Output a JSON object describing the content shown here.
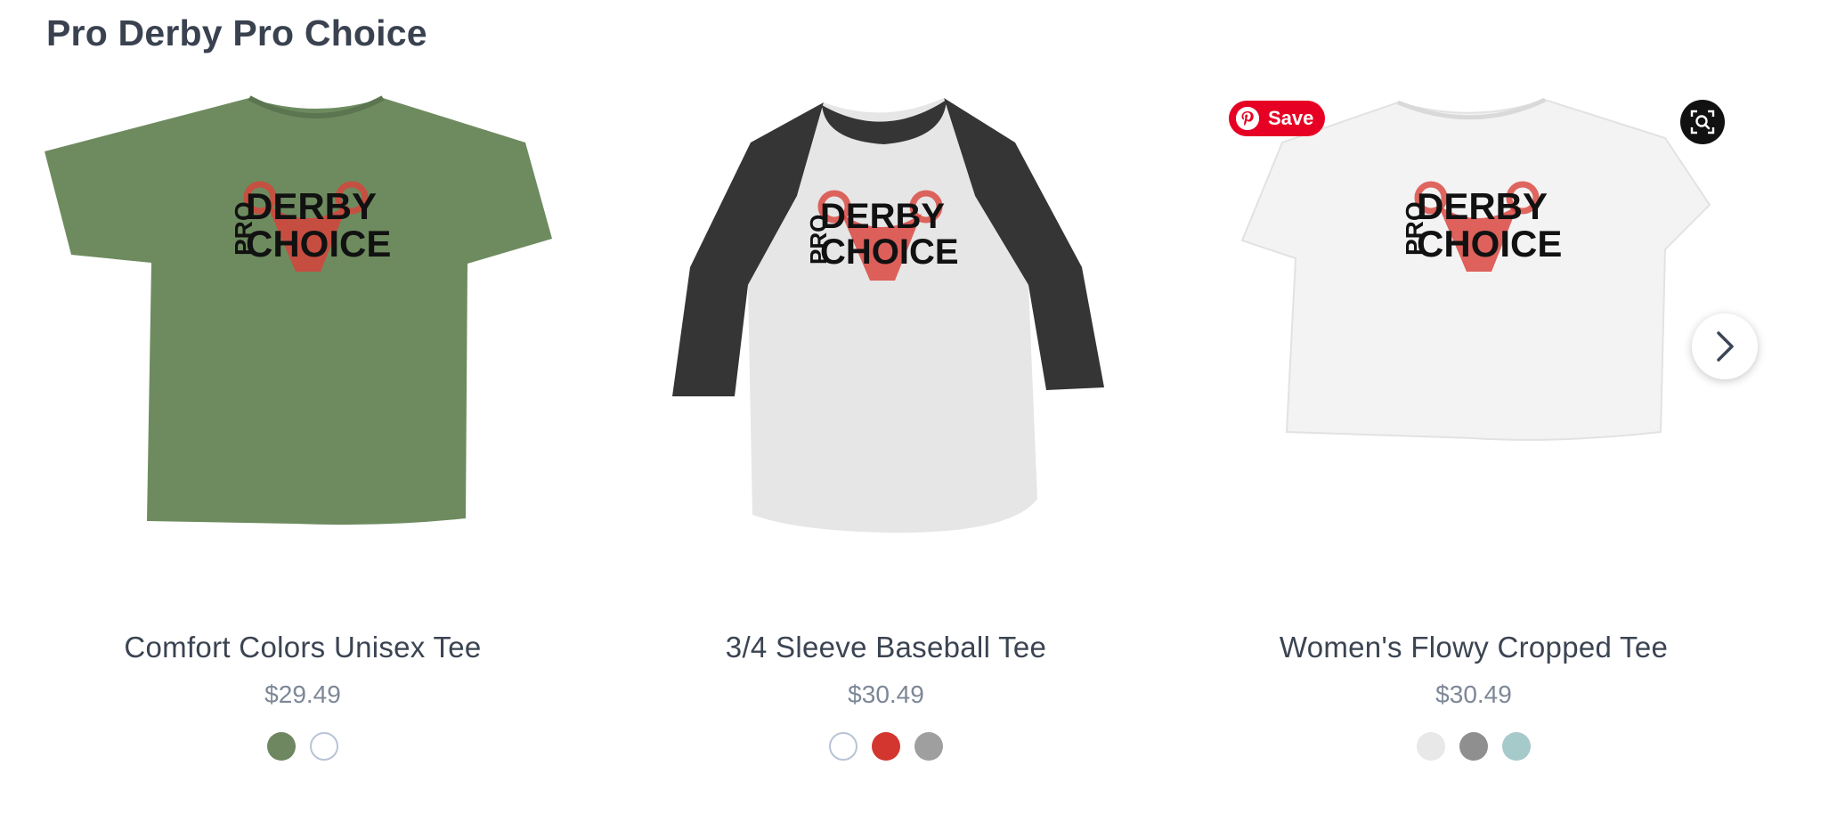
{
  "section": {
    "title": "Pro Derby Pro Choice"
  },
  "products": [
    {
      "name": "Comfort Colors Unisex Tee",
      "price": "$29.49",
      "shirt_color": "#6e8b5f",
      "swatches": [
        "#6f8761",
        "#ffffff"
      ]
    },
    {
      "name": "3/4 Sleeve Baseball Tee",
      "price": "$30.49",
      "shirt_color": "#e4e4e4",
      "sleeve_color": "#353535",
      "swatches": [
        "#ffffff",
        "#d3362f",
        "#9f9f9f"
      ]
    },
    {
      "name": "Women's Flowy Cropped Tee",
      "price": "$30.49",
      "shirt_color": "#f3f3f3",
      "swatches": [
        "#e8e8e8",
        "#8f8f8f",
        "#a6c9ca"
      ]
    }
  ],
  "design_print": {
    "pro": "PRO",
    "line1": "DERBY",
    "line2": "CHOICE"
  },
  "pinterest": {
    "save_label": "Save"
  },
  "icons": {
    "pinterest": "pinterest-icon",
    "visual_search": "visual-search-icon",
    "next": "chevron-right-icon"
  }
}
